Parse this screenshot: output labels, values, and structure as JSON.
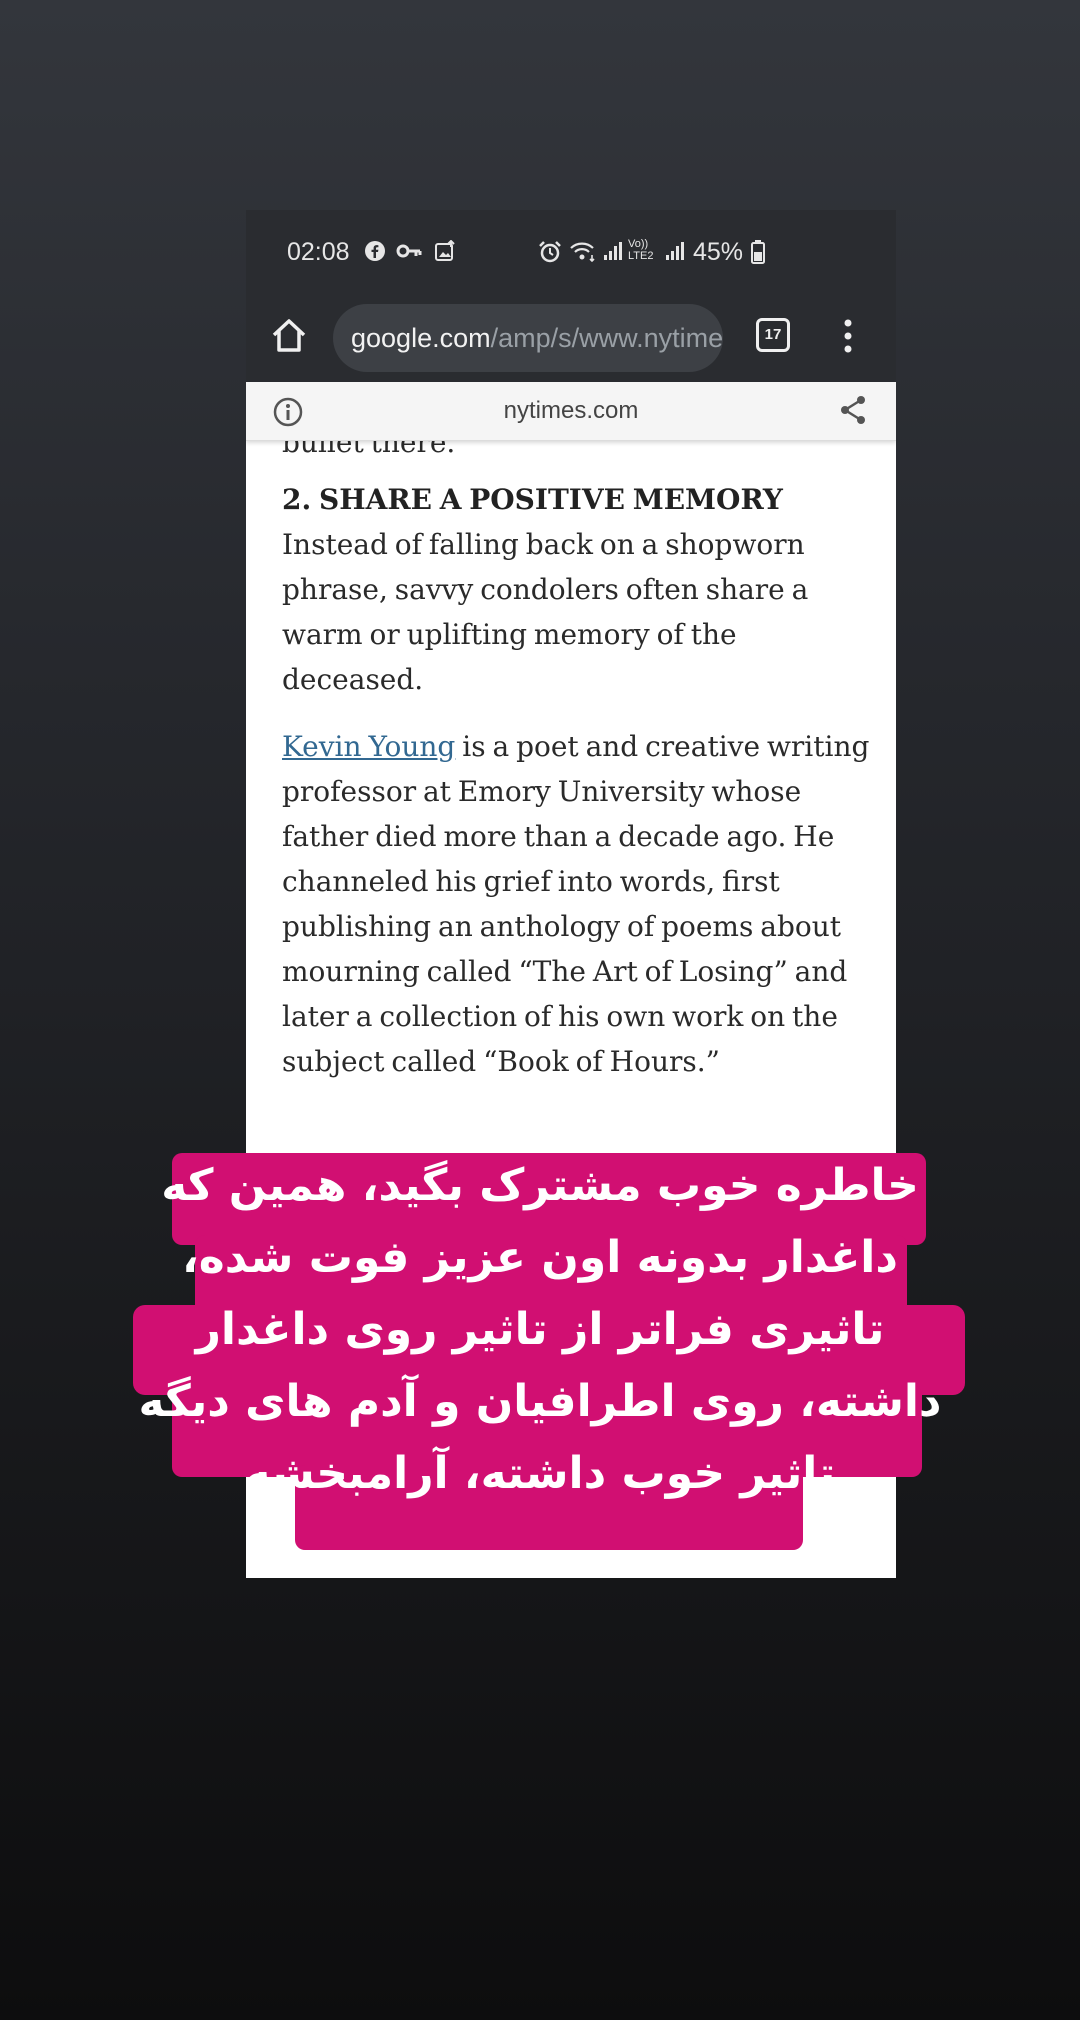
{
  "status_bar": {
    "time": "02:08",
    "network": "Vo)) LTE2",
    "battery": "45%"
  },
  "browser": {
    "url_domain": "google.com",
    "url_path": "/amp/s/www.nytimes.com",
    "tab_count": "17",
    "site": "nytimes.com"
  },
  "article": {
    "prev_line": "bullet there.”",
    "heading": "2. SHARE A POSITIVE MEMORY",
    "para1": "Instead of falling back on a shopworn phrase, savvy condolers often share a warm or uplifting memory of the deceased.",
    "link": "Kevin Young",
    "para2_rest": " is a poet and creative writing professor at Emory University whose father died more than a decade ago. He channeled his grief into words, first publishing an anthology of poems about mourning called “The Art of Losing” and later a collection of his own work on the subject called “Book of Hours.”"
  },
  "overlay": {
    "caption": "خاطره خوب مشترک بگید، همین که داغدار بدونه اون عزیز فوت شده، تاثیری فراتر از تاثیر روی داغدار داشته، روی اطرافیان و آدم های دیگه تاثیر خوب داشته، آرامبخشه",
    "highlight_color": "#d10f72"
  },
  "colors": {
    "status_bg": "#2a2c30",
    "link": "#326891"
  }
}
